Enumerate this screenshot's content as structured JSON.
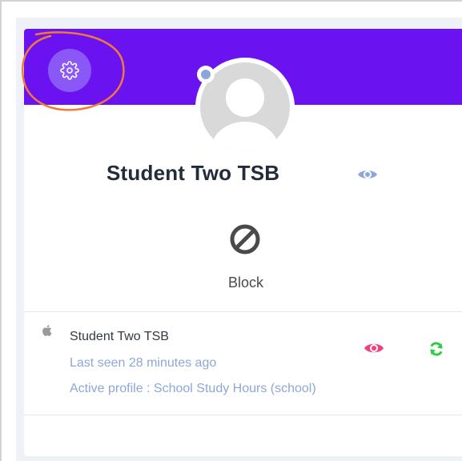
{
  "profile": {
    "name": "Student Two TSB",
    "banner_color": "#6a12f0",
    "block_label": "Block"
  },
  "device": {
    "icon": "apple-icon",
    "name": "Student Two TSB",
    "last_seen": "Last seen 28 minutes ago",
    "active_profile": "Active profile : School Study Hours (school)"
  },
  "icons": {
    "settings": "gear-icon",
    "view_profile": "eye-icon",
    "block": "block-icon",
    "view_device": "eye-icon",
    "refresh": "refresh-icon"
  },
  "colors": {
    "accent_light": "#8a58f6",
    "muted_blue": "#8fa6d8",
    "pink": "#f0417a",
    "green": "#2ecc40",
    "annotation_orange": "#f07a3a"
  }
}
